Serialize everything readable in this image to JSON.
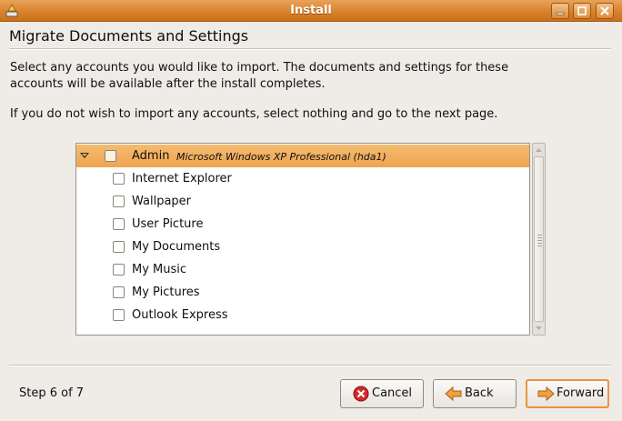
{
  "window": {
    "title": "Install",
    "app_icon": "installer-icon",
    "controls": [
      "minimize-icon",
      "maximize-icon",
      "close-icon"
    ]
  },
  "page": {
    "heading": "Migrate Documents and Settings",
    "description": "Select any accounts you would like to import.  The documents and settings for these accounts will be available after the install completes.",
    "hint": "If you do not wish to import any accounts, select nothing and go to the next page."
  },
  "accounts": {
    "account": {
      "name": "Admin",
      "os": "Microsoft Windows XP Professional (hda1)",
      "expanded": true,
      "selected": true,
      "checked": false
    },
    "items": [
      {
        "label": "Internet Explorer",
        "checked": false
      },
      {
        "label": "Wallpaper",
        "checked": false
      },
      {
        "label": "User Picture",
        "checked": false
      },
      {
        "label": "My Documents",
        "checked": false
      },
      {
        "label": "My Music",
        "checked": false
      },
      {
        "label": "My Pictures",
        "checked": false
      },
      {
        "label": "Outlook Express",
        "checked": false
      }
    ]
  },
  "footer": {
    "step": "Step 6 of 7",
    "cancel_label": "Cancel",
    "back_label": "Back",
    "forward_label": "Forward"
  },
  "colors": {
    "titlebar": "#d9822b",
    "selection": "#efa450",
    "background": "#efebe7",
    "focus_ring": "#e8953e"
  }
}
